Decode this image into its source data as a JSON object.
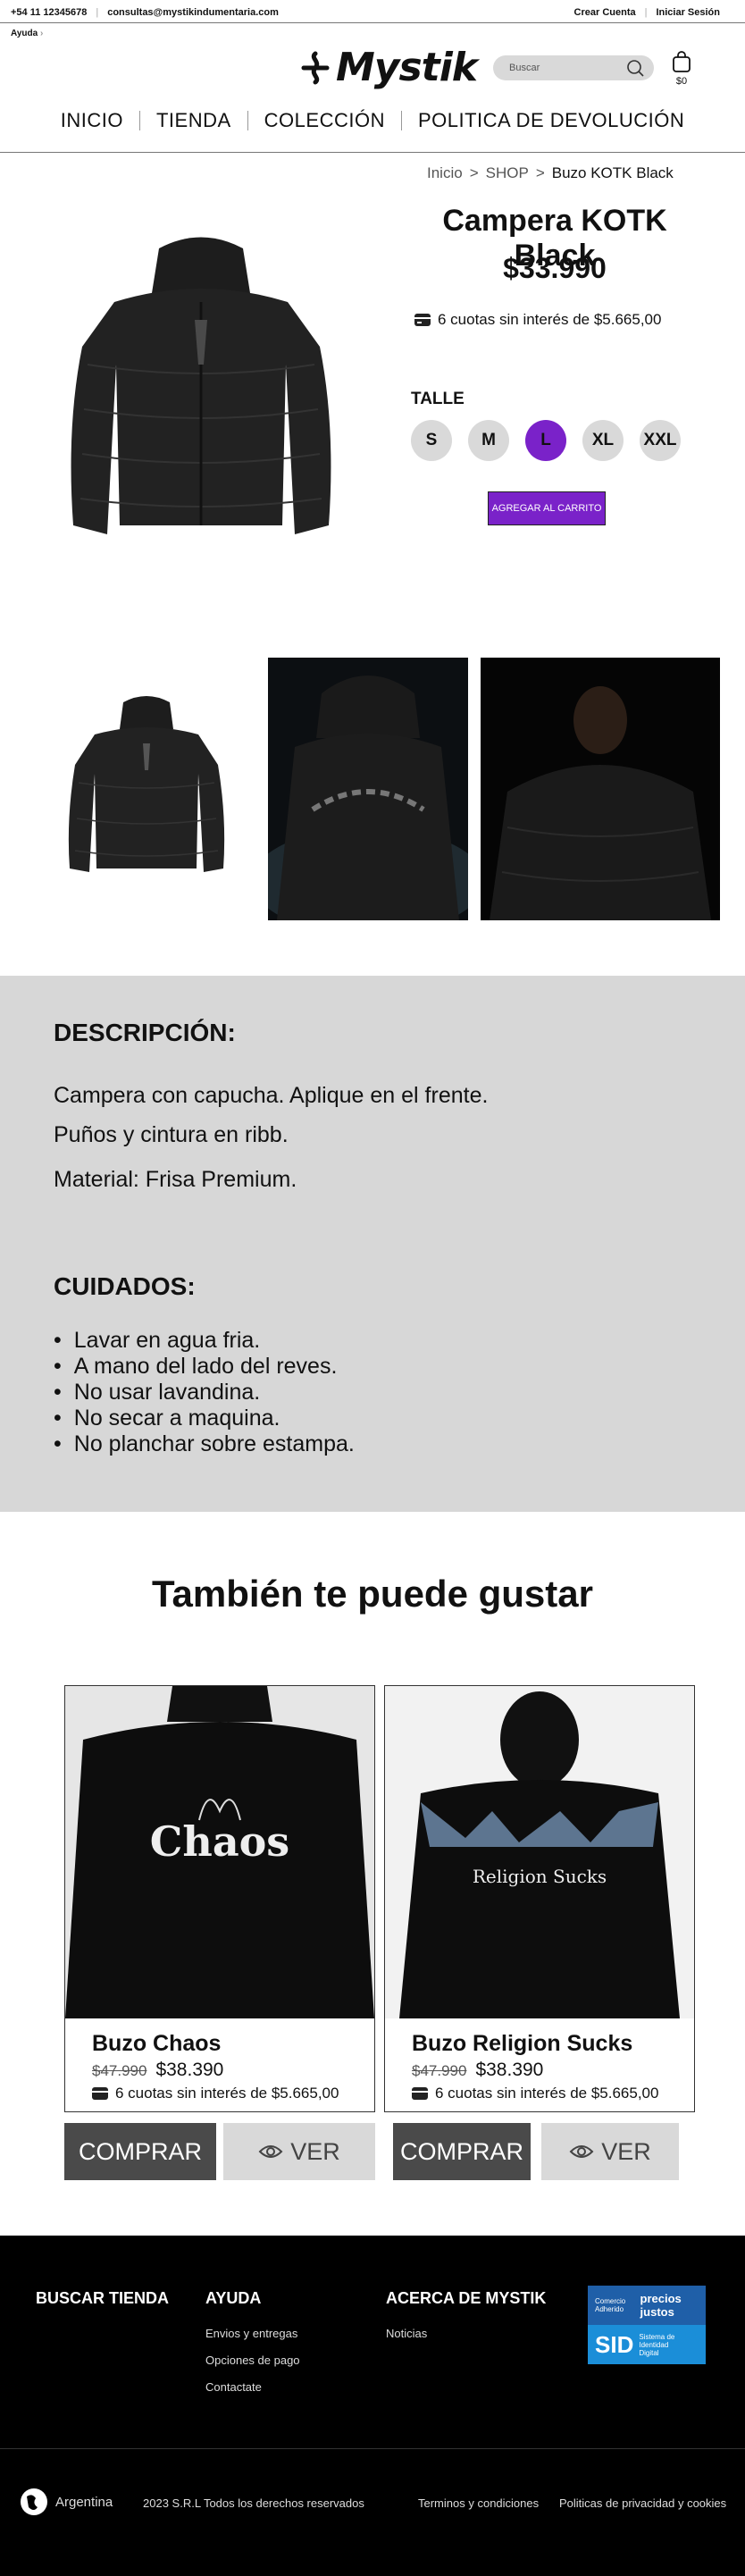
{
  "topbar": {
    "phone": "+54 11 12345678",
    "email": "consultas@mystikindumentaria.com",
    "create_account": "Crear Cuenta",
    "login": "Iniciar Sesión",
    "help": "Ayuda"
  },
  "header": {
    "logo": "Mystik",
    "search_placeholder": "Buscar",
    "cart_total": "$0"
  },
  "nav": [
    "INICIO",
    "TIENDA",
    "COLECCIÓN",
    "POLITICA DE DEVOLUCIÓN"
  ],
  "breadcrumb": {
    "home": "Inicio",
    "shop": "SHOP",
    "current": "Buzo KOTK Black",
    "sep": ">"
  },
  "product": {
    "title": "Campera KOTK Black",
    "price": "$33.990",
    "installments": "6 cuotas sin interés de $5.665,00",
    "size_label": "TALLE",
    "sizes": [
      "S",
      "M",
      "L",
      "XL",
      "XXL"
    ],
    "selected_size": "L",
    "add_to_cart": "AGREGAR AL CARRITO"
  },
  "description": {
    "title": "DESCRIPCIÓN:",
    "lines": [
      "Campera con capucha. Aplique en el frente.",
      "Puños y cintura en ribb.",
      "Material: Frisa Premium."
    ],
    "care_title": "CUIDADOS:",
    "care": [
      "Lavar en agua fria.",
      "A mano del lado del reves.",
      "No usar lavandina.",
      "No secar a maquina.",
      "No planchar sobre estampa."
    ]
  },
  "related": {
    "title": "También te puede gustar",
    "items": [
      {
        "name": "Buzo Chaos",
        "old_price": "$47.990",
        "price": "$38.390",
        "installments": "6 cuotas sin interés de $5.665,00",
        "print": "Chaos"
      },
      {
        "name": "Buzo Religion Sucks",
        "old_price": "$47.990",
        "price": "$38.390",
        "installments": "6 cuotas sin interés de $5.665,00",
        "print": "Religion Sucks"
      }
    ],
    "buy": "COMPRAR",
    "see": "VER"
  },
  "footer": {
    "store": "BUSCAR TIENDA",
    "help": "AYUDA",
    "help_links": [
      "Envios y entregas",
      "Opciones de pago",
      "Contactate"
    ],
    "about": "ACERCA DE MYSTIK",
    "about_links": [
      "Noticias"
    ],
    "badge_top_left": "Comercio Adherido",
    "badge_top_right": "precios justos",
    "badge_bottom": "SID",
    "badge_bottom_sub": "Sistema de Identidad Digital",
    "country": "Argentina",
    "copyright": "2023 S.R.L Todos los derechos reservados",
    "terms": "Terminos y condiciones",
    "privacy": "Politicas de privacidad y cookies"
  },
  "colors": {
    "accent": "#7a22c9",
    "description_bg": "#d7d7d7",
    "buy_button": "#4a4a4a"
  }
}
